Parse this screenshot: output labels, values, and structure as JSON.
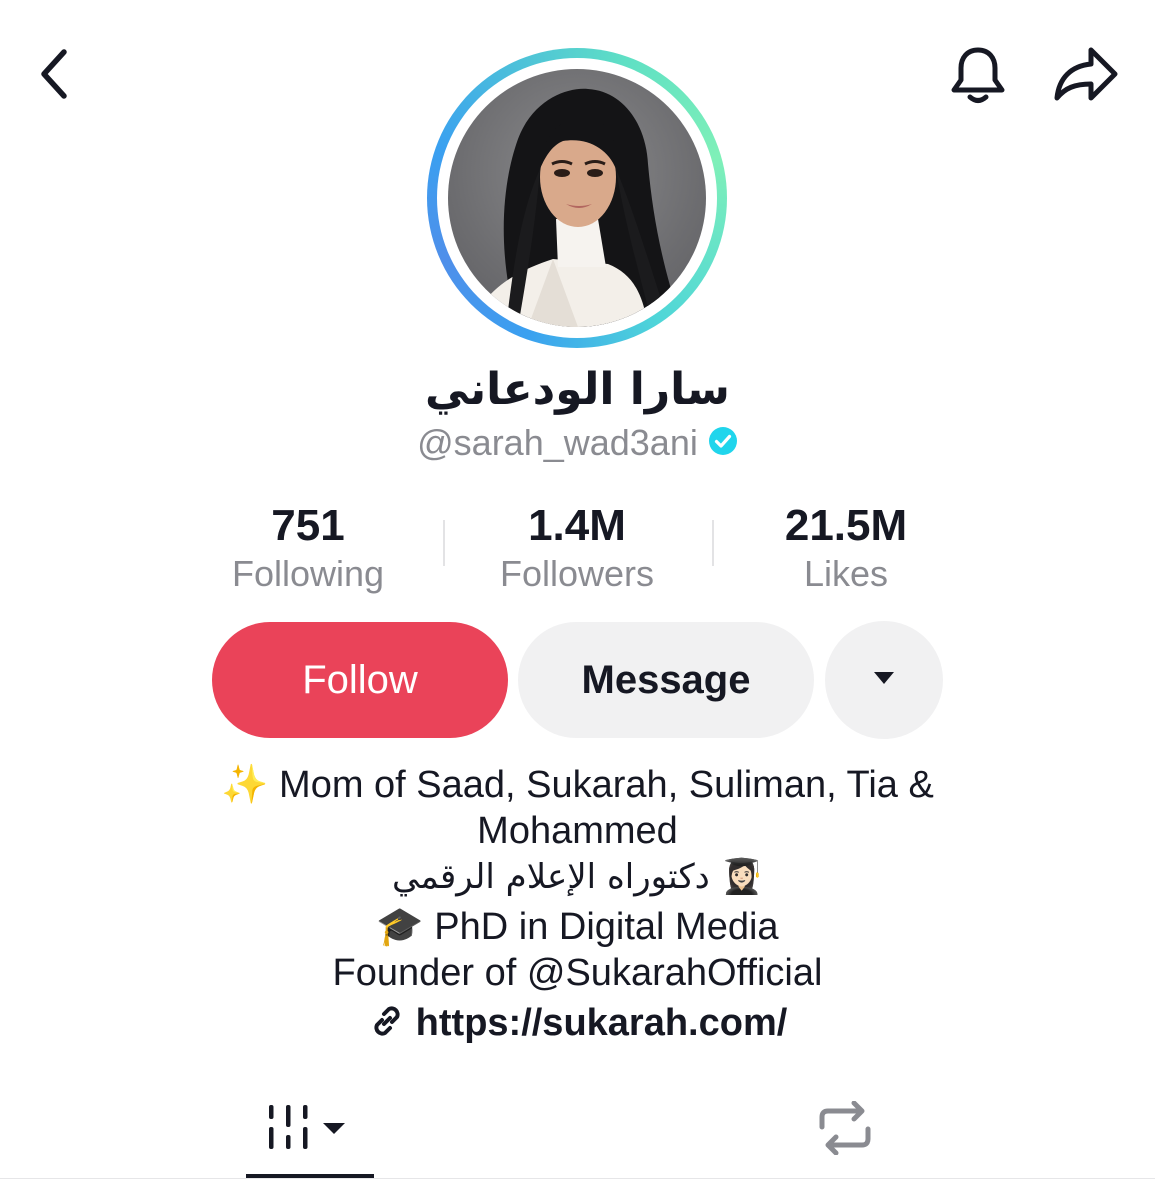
{
  "header": {
    "back_icon": "chevron-left-icon",
    "bell_icon": "bell-icon",
    "share_icon": "share-arrow-icon"
  },
  "profile": {
    "display_name": "سارا الودعاني",
    "handle": "@sarah_wad3ani",
    "verified": true,
    "ring_colors": [
      "#3aa0f0",
      "#7ff0b8"
    ]
  },
  "stats": {
    "following": {
      "value": "751",
      "label": "Following"
    },
    "followers": {
      "value": "1.4M",
      "label": "Followers"
    },
    "likes": {
      "value": "21.5M",
      "label": "Likes"
    }
  },
  "actions": {
    "follow_label": "Follow",
    "message_label": "Message",
    "more_icon": "caret-down-icon",
    "follow_color": "#ea4359"
  },
  "bio": {
    "line1": "✨ Mom of Saad, Sukarah, Suliman, Tia &",
    "line2": "Mohammed",
    "line3": "دكتوراه الإعلام الرقمي 👩🏻‍🎓",
    "line4": "🎓 PhD in Digital Media",
    "line5": "Founder of @SukarahOfficial",
    "link": "https://sukarah.com/",
    "link_icon": "link-icon"
  },
  "tabs": {
    "videos_icon": "video-grid-icon",
    "reposts_icon": "repost-icon",
    "active": "videos"
  }
}
